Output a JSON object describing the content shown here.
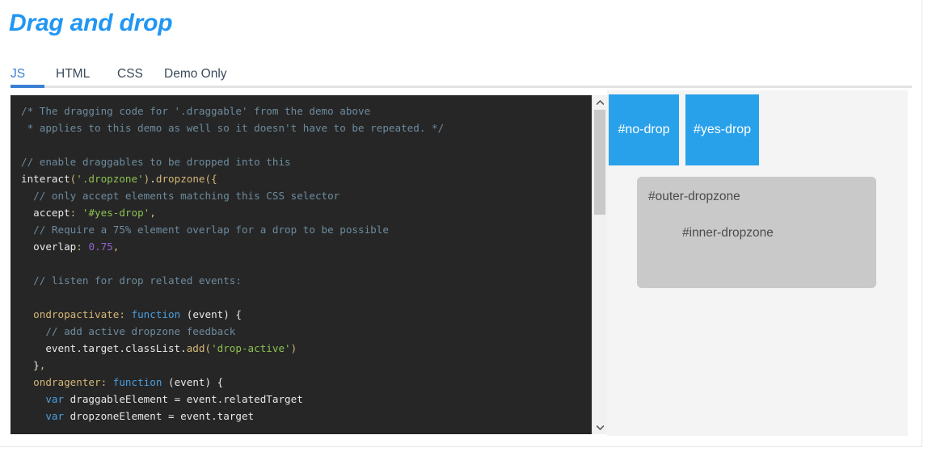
{
  "page": {
    "title": "Drag and drop"
  },
  "tabs": [
    {
      "label": "JS",
      "active": true
    },
    {
      "label": "HTML",
      "active": false
    },
    {
      "label": "CSS",
      "active": false
    },
    {
      "label": "Demo Only",
      "active": false
    }
  ],
  "code": {
    "language": "JS",
    "lines": [
      "/* The dragging code for '.draggable' from the demo above",
      " * applies to this demo as well so it doesn't have to be repeated. */",
      "",
      "// enable draggables to be dropped into this",
      "interact('.dropzone').dropzone({",
      "  // only accept elements matching this CSS selector",
      "  accept: '#yes-drop',",
      "  // Require a 75% element overlap for a drop to be possible",
      "  overlap: 0.75,",
      "",
      "  // listen for drop related events:",
      "",
      "  ondropactivate: function (event) {",
      "    // add active dropzone feedback",
      "    event.target.classList.add('drop-active')",
      "  },",
      "  ondragenter: function (event) {",
      "    var draggableElement = event.relatedTarget",
      "    var dropzoneElement = event.target"
    ]
  },
  "scrollbar": {
    "up_arrow": "chevron-up-icon",
    "down_arrow": "chevron-down-icon"
  },
  "demo": {
    "draggables": [
      {
        "label": "#no-drop"
      },
      {
        "label": "#yes-drop"
      }
    ],
    "outer_dropzone_label": "#outer-dropzone",
    "inner_dropzone_label": "#inner-dropzone"
  },
  "colors": {
    "accent": "#2196f3",
    "tab_active": "#3b7fd4",
    "draggable": "#29a1ea",
    "dropzone": "#c9c9c9",
    "code_bg": "#262626",
    "demo_bg": "#f4f4f4"
  }
}
